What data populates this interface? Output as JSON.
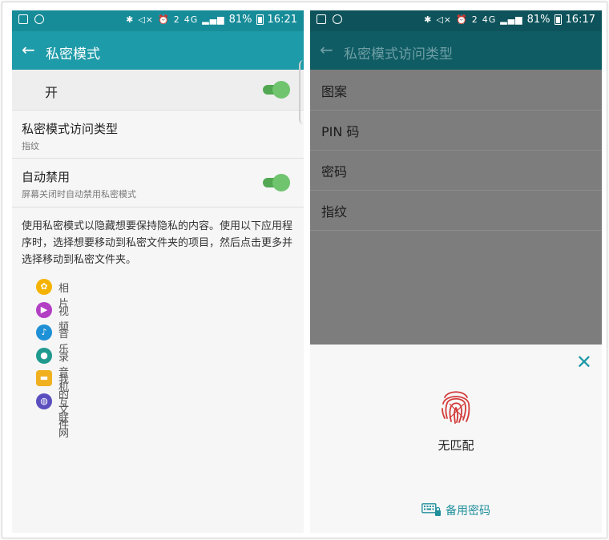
{
  "status_bar": {
    "left": {
      "battery_pct": "81%",
      "time": "16:21"
    },
    "right": {
      "battery_pct": "81%",
      "time": "16:17"
    },
    "net_label": "4G",
    "sim_label": "2",
    "icons": [
      "image-icon",
      "block-icon",
      "bluetooth-icon",
      "mute-icon",
      "alarm-icon",
      "sim-icon",
      "signal-icon",
      "battery-icon"
    ]
  },
  "left_screen": {
    "title": "私密模式",
    "master_switch": {
      "label": "开",
      "on": true
    },
    "access_type": {
      "title": "私密模式访问类型",
      "value": "指纹"
    },
    "auto_disable": {
      "title": "自动禁用",
      "subtitle": "屏幕关闭时自动禁用私密模式",
      "on": true
    },
    "description": "使用私密模式以隐藏想要保持隐私的内容。使用以下应用程序时，选择想要移动到私密文件夹的项目，然后点击更多并选择移动到私密文件夹。",
    "apps": [
      {
        "name": "相片",
        "icon": "gallery-icon",
        "color": "#f5b301"
      },
      {
        "name": "视频",
        "icon": "video-icon",
        "color": "#b23fc4"
      },
      {
        "name": "音乐",
        "icon": "music-icon",
        "color": "#1e90d6"
      },
      {
        "name": "录音机",
        "icon": "voice-recorder-icon",
        "color": "#1f9a8e"
      },
      {
        "name": "我的文件",
        "icon": "my-files-icon",
        "color": "#f0b020"
      },
      {
        "name": "互联网",
        "icon": "internet-icon",
        "color": "#5b4fbf"
      }
    ]
  },
  "right_screen": {
    "title": "私密模式访问类型",
    "options": [
      "图案",
      "PIN 码",
      "密码",
      "指纹"
    ],
    "dialog": {
      "message": "无匹配",
      "backup_label": "备用密码"
    }
  },
  "colors": {
    "appbar": "#1e9ba8",
    "statusbar": "#178c99",
    "appbar_dimmed": "#0f5c64",
    "toggle_on": "#6fc46d",
    "accent": "#1f9aa8",
    "fingerprint_red": "#d33a3a"
  }
}
